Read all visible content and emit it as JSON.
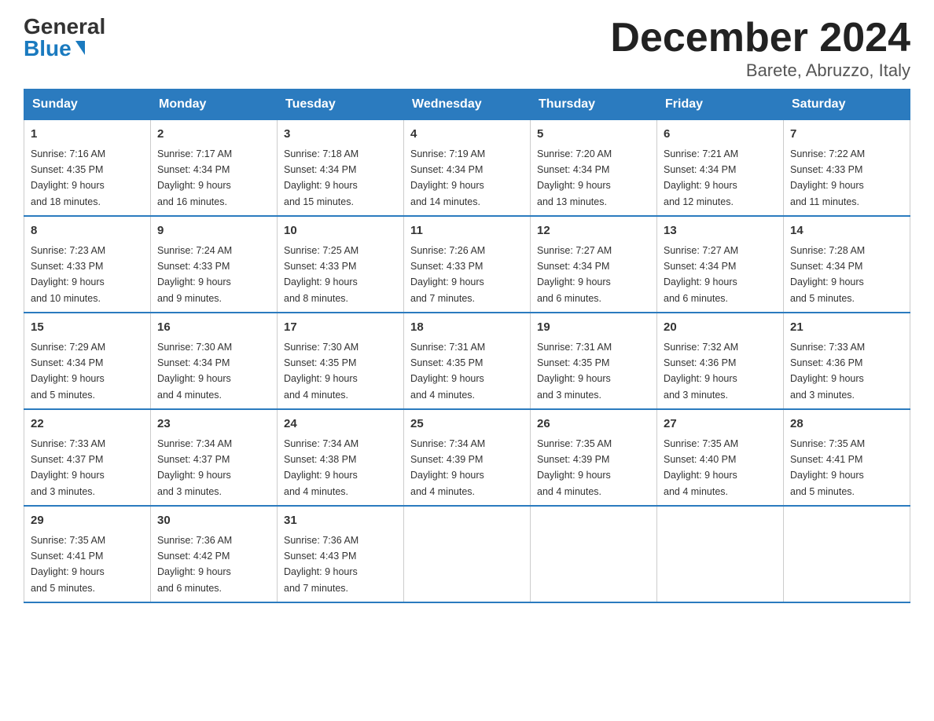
{
  "logo": {
    "general": "General",
    "blue": "Blue"
  },
  "title": "December 2024",
  "subtitle": "Barete, Abruzzo, Italy",
  "days_of_week": [
    "Sunday",
    "Monday",
    "Tuesday",
    "Wednesday",
    "Thursday",
    "Friday",
    "Saturday"
  ],
  "weeks": [
    [
      {
        "day": "1",
        "sunrise": "7:16 AM",
        "sunset": "4:35 PM",
        "daylight": "9 hours and 18 minutes."
      },
      {
        "day": "2",
        "sunrise": "7:17 AM",
        "sunset": "4:34 PM",
        "daylight": "9 hours and 16 minutes."
      },
      {
        "day": "3",
        "sunrise": "7:18 AM",
        "sunset": "4:34 PM",
        "daylight": "9 hours and 15 minutes."
      },
      {
        "day": "4",
        "sunrise": "7:19 AM",
        "sunset": "4:34 PM",
        "daylight": "9 hours and 14 minutes."
      },
      {
        "day": "5",
        "sunrise": "7:20 AM",
        "sunset": "4:34 PM",
        "daylight": "9 hours and 13 minutes."
      },
      {
        "day": "6",
        "sunrise": "7:21 AM",
        "sunset": "4:34 PM",
        "daylight": "9 hours and 12 minutes."
      },
      {
        "day": "7",
        "sunrise": "7:22 AM",
        "sunset": "4:33 PM",
        "daylight": "9 hours and 11 minutes."
      }
    ],
    [
      {
        "day": "8",
        "sunrise": "7:23 AM",
        "sunset": "4:33 PM",
        "daylight": "9 hours and 10 minutes."
      },
      {
        "day": "9",
        "sunrise": "7:24 AM",
        "sunset": "4:33 PM",
        "daylight": "9 hours and 9 minutes."
      },
      {
        "day": "10",
        "sunrise": "7:25 AM",
        "sunset": "4:33 PM",
        "daylight": "9 hours and 8 minutes."
      },
      {
        "day": "11",
        "sunrise": "7:26 AM",
        "sunset": "4:33 PM",
        "daylight": "9 hours and 7 minutes."
      },
      {
        "day": "12",
        "sunrise": "7:27 AM",
        "sunset": "4:34 PM",
        "daylight": "9 hours and 6 minutes."
      },
      {
        "day": "13",
        "sunrise": "7:27 AM",
        "sunset": "4:34 PM",
        "daylight": "9 hours and 6 minutes."
      },
      {
        "day": "14",
        "sunrise": "7:28 AM",
        "sunset": "4:34 PM",
        "daylight": "9 hours and 5 minutes."
      }
    ],
    [
      {
        "day": "15",
        "sunrise": "7:29 AM",
        "sunset": "4:34 PM",
        "daylight": "9 hours and 5 minutes."
      },
      {
        "day": "16",
        "sunrise": "7:30 AM",
        "sunset": "4:34 PM",
        "daylight": "9 hours and 4 minutes."
      },
      {
        "day": "17",
        "sunrise": "7:30 AM",
        "sunset": "4:35 PM",
        "daylight": "9 hours and 4 minutes."
      },
      {
        "day": "18",
        "sunrise": "7:31 AM",
        "sunset": "4:35 PM",
        "daylight": "9 hours and 4 minutes."
      },
      {
        "day": "19",
        "sunrise": "7:31 AM",
        "sunset": "4:35 PM",
        "daylight": "9 hours and 3 minutes."
      },
      {
        "day": "20",
        "sunrise": "7:32 AM",
        "sunset": "4:36 PM",
        "daylight": "9 hours and 3 minutes."
      },
      {
        "day": "21",
        "sunrise": "7:33 AM",
        "sunset": "4:36 PM",
        "daylight": "9 hours and 3 minutes."
      }
    ],
    [
      {
        "day": "22",
        "sunrise": "7:33 AM",
        "sunset": "4:37 PM",
        "daylight": "9 hours and 3 minutes."
      },
      {
        "day": "23",
        "sunrise": "7:34 AM",
        "sunset": "4:37 PM",
        "daylight": "9 hours and 3 minutes."
      },
      {
        "day": "24",
        "sunrise": "7:34 AM",
        "sunset": "4:38 PM",
        "daylight": "9 hours and 4 minutes."
      },
      {
        "day": "25",
        "sunrise": "7:34 AM",
        "sunset": "4:39 PM",
        "daylight": "9 hours and 4 minutes."
      },
      {
        "day": "26",
        "sunrise": "7:35 AM",
        "sunset": "4:39 PM",
        "daylight": "9 hours and 4 minutes."
      },
      {
        "day": "27",
        "sunrise": "7:35 AM",
        "sunset": "4:40 PM",
        "daylight": "9 hours and 4 minutes."
      },
      {
        "day": "28",
        "sunrise": "7:35 AM",
        "sunset": "4:41 PM",
        "daylight": "9 hours and 5 minutes."
      }
    ],
    [
      {
        "day": "29",
        "sunrise": "7:35 AM",
        "sunset": "4:41 PM",
        "daylight": "9 hours and 5 minutes."
      },
      {
        "day": "30",
        "sunrise": "7:36 AM",
        "sunset": "4:42 PM",
        "daylight": "9 hours and 6 minutes."
      },
      {
        "day": "31",
        "sunrise": "7:36 AM",
        "sunset": "4:43 PM",
        "daylight": "9 hours and 7 minutes."
      },
      null,
      null,
      null,
      null
    ]
  ]
}
